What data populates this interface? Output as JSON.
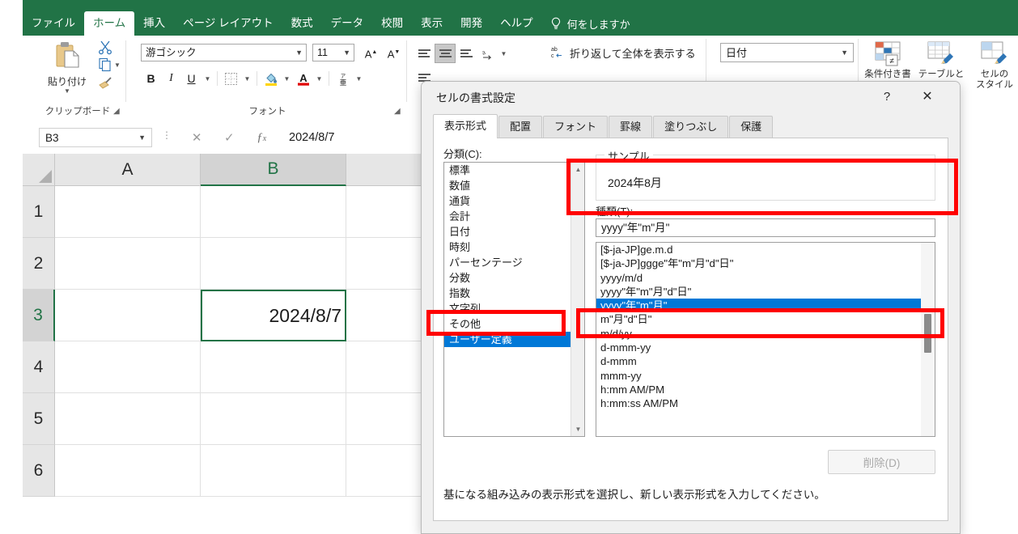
{
  "app": {
    "ribbon_tabs": [
      {
        "label": "ファイル",
        "active": false
      },
      {
        "label": "ホーム",
        "active": true
      },
      {
        "label": "挿入",
        "active": false
      },
      {
        "label": "ページ レイアウト",
        "active": false
      },
      {
        "label": "数式",
        "active": false
      },
      {
        "label": "データ",
        "active": false
      },
      {
        "label": "校閲",
        "active": false
      },
      {
        "label": "表示",
        "active": false
      },
      {
        "label": "開発",
        "active": false
      },
      {
        "label": "ヘルプ",
        "active": false
      }
    ],
    "tell_me": "何をしますか",
    "accent_green": "#217346"
  },
  "ribbon": {
    "clipboard": {
      "group_label": "クリップボード",
      "paste_label": "貼り付け",
      "cut_icon": "scissors-icon",
      "copy_icon": "copy-icon",
      "format_painter_icon": "format-painter-icon"
    },
    "font": {
      "group_label": "フォント",
      "font_name": "游ゴシック",
      "font_size": "11",
      "grow_font": "A",
      "shrink_font": "A",
      "bold": "B",
      "italic": "I",
      "underline": "U",
      "border_icon": "borders-icon",
      "fill_icon": "fill-color-icon",
      "font_color_icon": "font-color-icon",
      "phonetic_icon": "phonetic-guide-icon"
    },
    "alignment": {
      "align_left_icon": "align-left-icon",
      "align_center_icon": "align-center-icon",
      "align_right_icon": "align-right-icon",
      "orientation_icon": "orientation-icon",
      "wrap_text_label": "折り返して全体を表示する",
      "wrap_text_icon": "wrap-text-icon"
    },
    "number": {
      "format_value": "日付"
    },
    "styles": {
      "conditional_formatting_label": "条件付き書",
      "table_style_label": "テーブルと",
      "cell_styles_label": "セルの\nスタイル"
    }
  },
  "formula_bar": {
    "name_box": "B3",
    "cancel_icon": "cancel-icon",
    "enter_icon": "enter-icon",
    "fx_icon": "fx-icon",
    "formula": "2024/8/7"
  },
  "sheet": {
    "columns": [
      "A",
      "B"
    ],
    "selected_column": "B",
    "rows": [
      "1",
      "2",
      "3",
      "4",
      "5",
      "6"
    ],
    "selected_row": "3",
    "active_cell": "B3",
    "cells": [
      {
        "ref": "B3",
        "value": "2024/8/7"
      }
    ]
  },
  "dialog": {
    "title": "セルの書式設定",
    "help_icon": "?",
    "close_icon": "✕",
    "tabs": [
      {
        "label": "表示形式",
        "active": true
      },
      {
        "label": "配置",
        "active": false
      },
      {
        "label": "フォント",
        "active": false
      },
      {
        "label": "罫線",
        "active": false
      },
      {
        "label": "塗りつぶし",
        "active": false
      },
      {
        "label": "保護",
        "active": false
      }
    ],
    "category_label": "分類(C):",
    "categories": [
      {
        "label": "標準",
        "selected": false
      },
      {
        "label": "数値",
        "selected": false
      },
      {
        "label": "通貨",
        "selected": false
      },
      {
        "label": "会計",
        "selected": false
      },
      {
        "label": "日付",
        "selected": false
      },
      {
        "label": "時刻",
        "selected": false
      },
      {
        "label": "パーセンテージ",
        "selected": false
      },
      {
        "label": "分数",
        "selected": false
      },
      {
        "label": "指数",
        "selected": false
      },
      {
        "label": "文字列",
        "selected": false
      },
      {
        "label": "その他",
        "selected": false
      },
      {
        "label": "ユーザー定義",
        "selected": true
      }
    ],
    "sample_label": "サンプル",
    "sample_value": "2024年8月",
    "type_label": "種類(T):",
    "type_input_value": "yyyy\"年\"m\"月\"",
    "type_items": [
      {
        "label": "[$-ja-JP]ge.m.d",
        "selected": false
      },
      {
        "label": "[$-ja-JP]ggge\"年\"m\"月\"d\"日\"",
        "selected": false
      },
      {
        "label": "yyyy/m/d",
        "selected": false
      },
      {
        "label": "yyyy\"年\"m\"月\"d\"日\"",
        "selected": false
      },
      {
        "label": "yyyy\"年\"m\"月\"",
        "selected": true
      },
      {
        "label": "m\"月\"d\"日\"",
        "selected": false
      },
      {
        "label": "m/d/yy",
        "selected": false
      },
      {
        "label": "d-mmm-yy",
        "selected": false
      },
      {
        "label": "d-mmm",
        "selected": false
      },
      {
        "label": "mmm-yy",
        "selected": false
      },
      {
        "label": "h:mm AM/PM",
        "selected": false
      },
      {
        "label": "h:mm:ss AM/PM",
        "selected": false
      }
    ],
    "delete_button": "削除(D)",
    "hint": "基になる組み込みの表示形式を選択し、新しい表示形式を入力してください。",
    "annotation_color": "#ff0000"
  }
}
